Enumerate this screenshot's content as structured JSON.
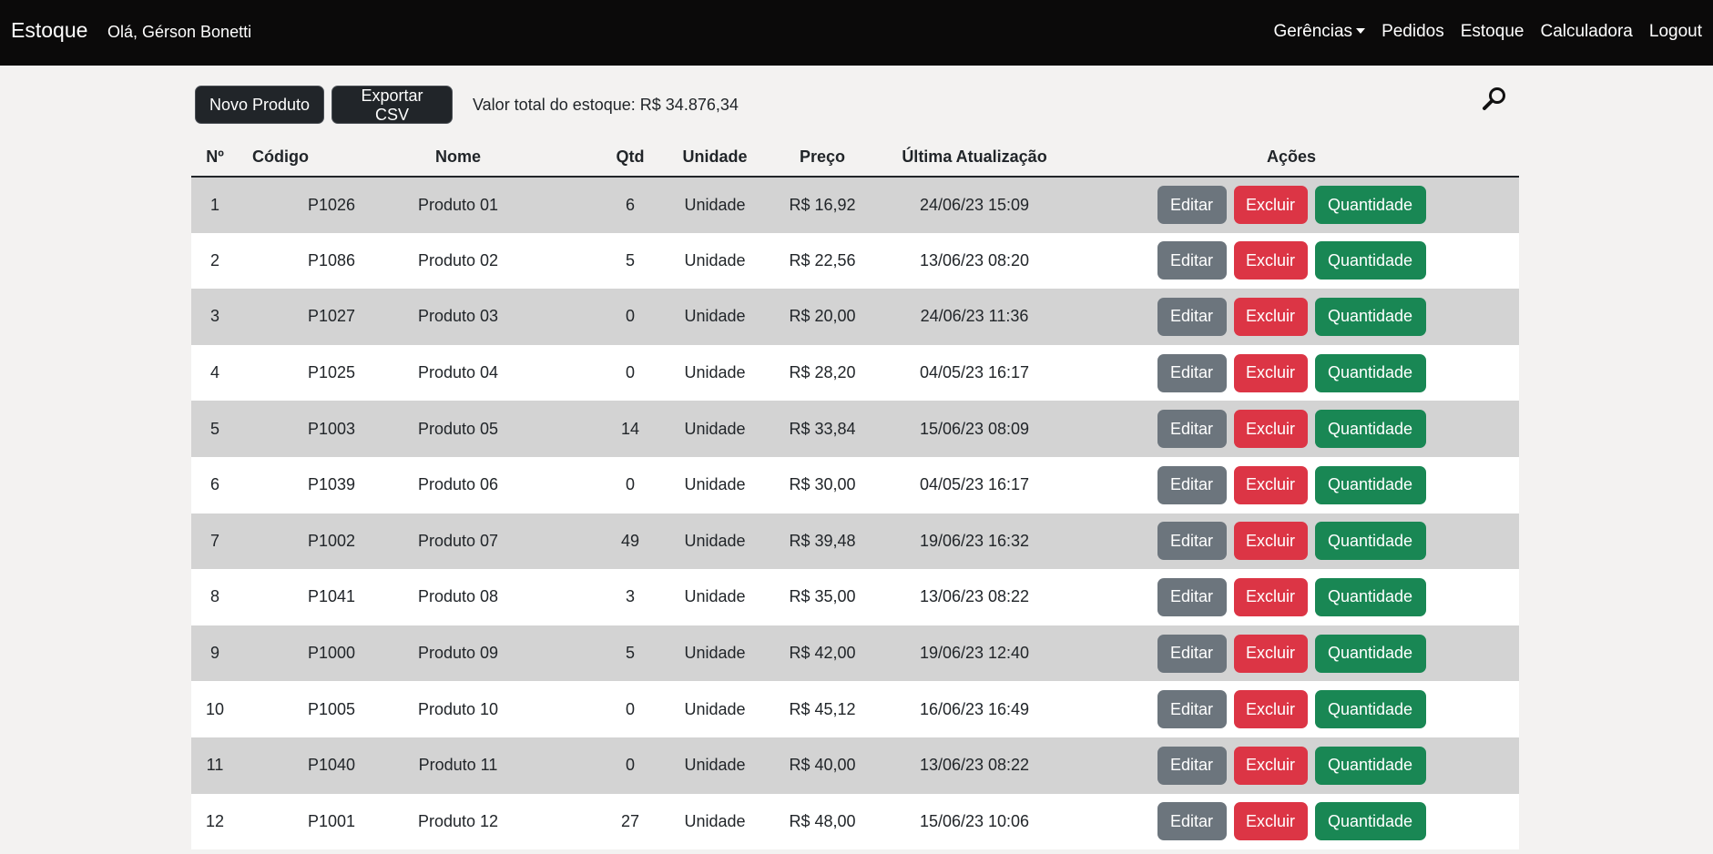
{
  "navbar": {
    "brand": "Estoque",
    "greeting": "Olá, Gérson Bonetti",
    "links": [
      "Gerências",
      "Pedidos",
      "Estoque",
      "Calculadora",
      "Logout"
    ]
  },
  "toolbar": {
    "new_product_label": "Novo Produto",
    "export_csv_label": "Exportar CSV",
    "total_value_text": "Valor total do estoque: R$ 34.876,34",
    "search_icon": "search-icon"
  },
  "table": {
    "headers": [
      "Nº",
      "Código",
      "Nome",
      "Qtd",
      "Unidade",
      "Preço",
      "Última Atualização",
      "Ações"
    ],
    "action_labels": {
      "edit": "Editar",
      "delete": "Excluir",
      "quantity": "Quantidade"
    },
    "rows": [
      [
        "1",
        "P1026",
        "Produto 01",
        "6",
        "Unidade",
        "R$ 16,92",
        "24/06/23 15:09"
      ],
      [
        "2",
        "P1086",
        "Produto 02",
        "5",
        "Unidade",
        "R$ 22,56",
        "13/06/23 08:20"
      ],
      [
        "3",
        "P1027",
        "Produto 03",
        "0",
        "Unidade",
        "R$ 20,00",
        "24/06/23 11:36"
      ],
      [
        "4",
        "P1025",
        "Produto 04",
        "0",
        "Unidade",
        "R$ 28,20",
        "04/05/23 16:17"
      ],
      [
        "5",
        "P1003",
        "Produto 05",
        "14",
        "Unidade",
        "R$ 33,84",
        "15/06/23 08:09"
      ],
      [
        "6",
        "P1039",
        "Produto 06",
        "0",
        "Unidade",
        "R$ 30,00",
        "04/05/23 16:17"
      ],
      [
        "7",
        "P1002",
        "Produto 07",
        "49",
        "Unidade",
        "R$ 39,48",
        "19/06/23 16:32"
      ],
      [
        "8",
        "P1041",
        "Produto 08",
        "3",
        "Unidade",
        "R$ 35,00",
        "13/06/23 08:22"
      ],
      [
        "9",
        "P1000",
        "Produto 09",
        "5",
        "Unidade",
        "R$ 42,00",
        "19/06/23 12:40"
      ],
      [
        "10",
        "P1005",
        "Produto 10",
        "0",
        "Unidade",
        "R$ 45,12",
        "16/06/23 16:49"
      ],
      [
        "11",
        "P1040",
        "Produto 11",
        "0",
        "Unidade",
        "R$ 40,00",
        "13/06/23 08:22"
      ],
      [
        "12",
        "P1001",
        "Produto 12",
        "27",
        "Unidade",
        "R$ 48,00",
        "15/06/23 10:06"
      ]
    ]
  },
  "colors": {
    "navbar_bg": "#0b0a0a",
    "page_bg": "#f3f2f1",
    "edit": "#6c757d",
    "delete": "#dc3545",
    "quantity": "#198754",
    "stripe": "#d3d3d3"
  }
}
